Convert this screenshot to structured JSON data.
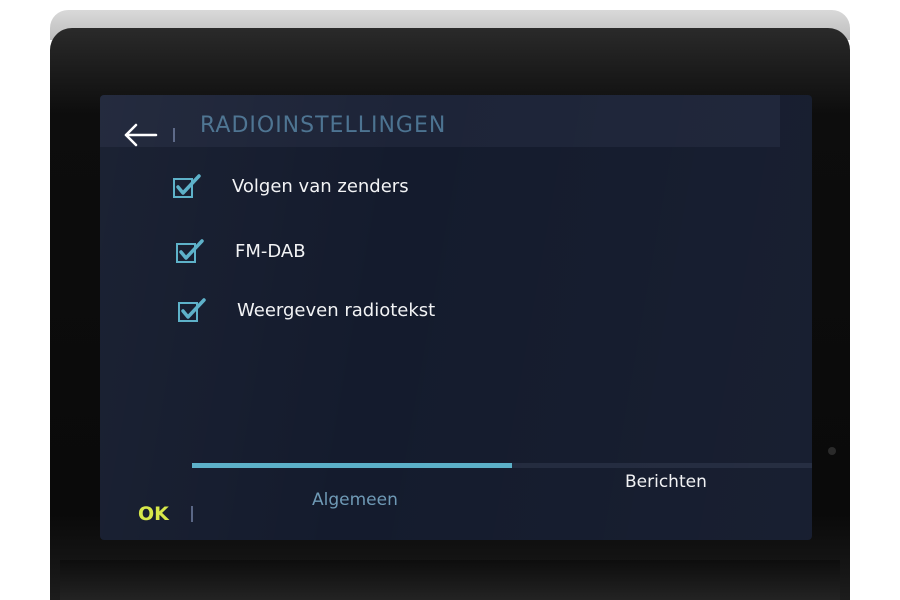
{
  "header": {
    "title": "RADIOINSTELLINGEN",
    "back_icon": "arrow-left-icon"
  },
  "options": [
    {
      "label": "Volgen van zenders",
      "checked": true
    },
    {
      "label": "FM-DAB",
      "checked": true
    },
    {
      "label": "Weergeven radiotekst",
      "checked": true
    }
  ],
  "tabs": {
    "items": [
      {
        "label": "Algemeen",
        "active": true
      },
      {
        "label": "Berichten",
        "active": false
      }
    ]
  },
  "footer": {
    "ok_label": "OK"
  },
  "colors": {
    "screen_background": "#141b2d",
    "title": "#4c7391",
    "checkbox_check": "#5bb0c8",
    "active_tab_indicator": "#5bb0c8",
    "ok_label": "#d7e84a",
    "text": "#f2f3f5"
  }
}
